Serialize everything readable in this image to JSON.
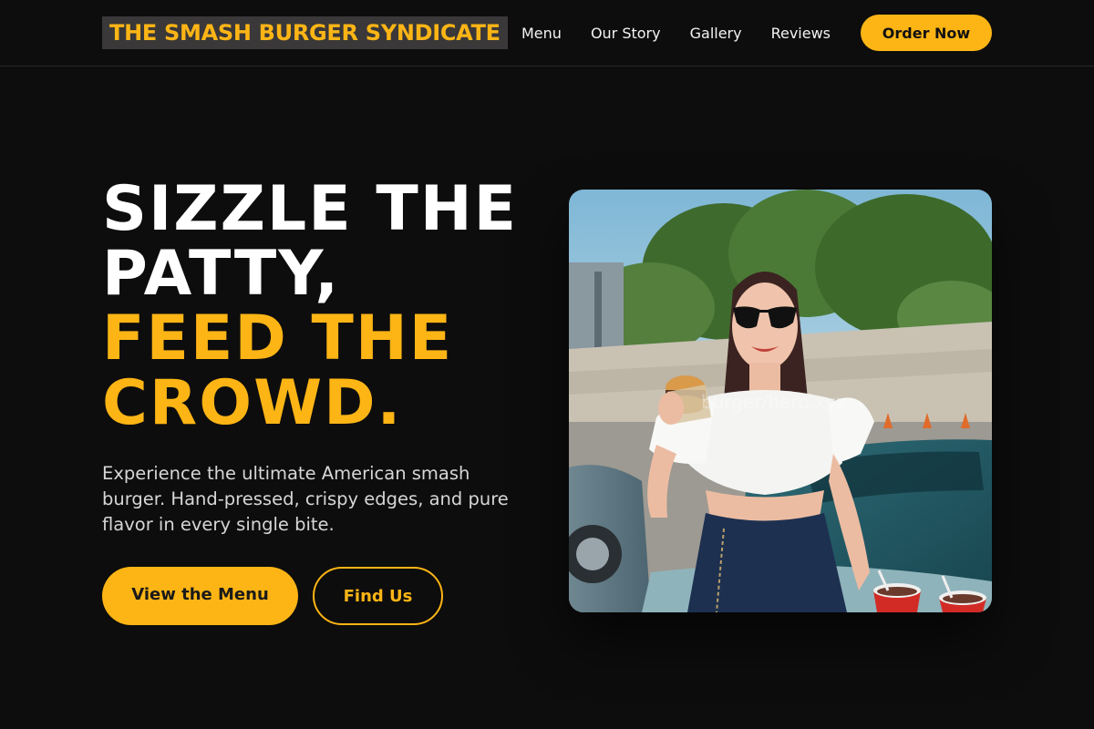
{
  "brand": {
    "name": "THE SMASH BURGER SYNDICATE"
  },
  "nav": {
    "items": [
      {
        "label": "Menu"
      },
      {
        "label": "Our Story"
      },
      {
        "label": "Gallery"
      },
      {
        "label": "Reviews"
      }
    ],
    "cta": "Order Now"
  },
  "hero": {
    "line1": "SIZZLE THE",
    "line2": "PATTY,",
    "line3": "FEED THE",
    "line4": "CROWD.",
    "subtitle": "Experience the ultimate American smash burger. Hand-pressed, crispy edges, and pure flavor in every single bite.",
    "primary_button": "View the Menu",
    "secondary_button": "Find Us",
    "image_watermark": "burger/hero.xyz"
  },
  "colors": {
    "accent": "#fdb515",
    "background": "#0e0d0d",
    "logo_bg": "#3a3838"
  }
}
